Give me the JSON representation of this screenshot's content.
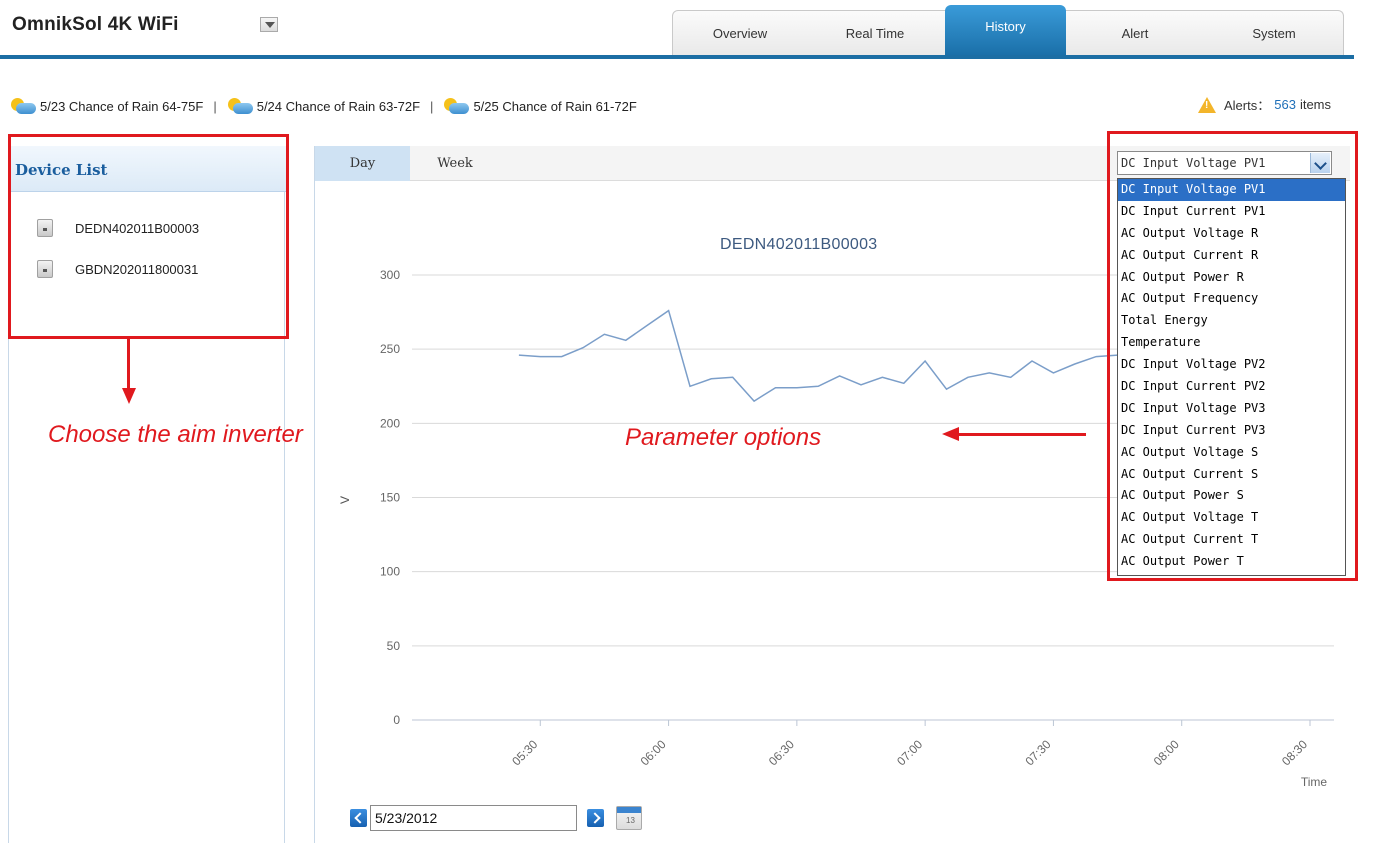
{
  "app": {
    "title": "OmnikSol 4K WiFi"
  },
  "tabs": [
    {
      "label": "Overview",
      "active": false
    },
    {
      "label": "Real Time",
      "active": false
    },
    {
      "label": "History",
      "active": true
    },
    {
      "label": "Alert",
      "active": false
    },
    {
      "label": "System",
      "active": false
    }
  ],
  "weather": [
    {
      "text": "5/23 Chance of Rain 64-75F",
      "icon": "partly-cloudy-icon"
    },
    {
      "text": "5/24 Chance of Rain 63-72F",
      "icon": "partly-cloudy-icon"
    },
    {
      "text": "5/25 Chance of Rain 61-72F",
      "icon": "partly-cloudy-icon"
    }
  ],
  "weather_separator": "|",
  "alerts": {
    "label": "Alerts：",
    "count": "563",
    "suffix": "items"
  },
  "device_list": {
    "title": "Device List",
    "devices": [
      "DEDN402011B00003",
      "GBDN202011800031"
    ]
  },
  "annotations": {
    "choose": "Choose the aim inverter",
    "params": "Parameter options"
  },
  "chart_tabs": [
    {
      "label": "Day",
      "active": true
    },
    {
      "label": "Week",
      "active": false
    }
  ],
  "parameter_select": {
    "selected": "DC Input Voltage PV1",
    "options": [
      "DC Input Voltage PV1",
      "DC Input Current PV1",
      "AC Output Voltage R",
      "AC Output Current R",
      "AC Output Power R",
      "AC Output Frequency",
      "Total Energy",
      "Temperature",
      "DC Input Voltage PV2",
      "DC Input Current PV2",
      "DC Input Voltage PV3",
      "DC Input Current PV3",
      "AC Output Voltage S",
      "AC Output Current S",
      "AC Output Power S",
      "AC Output Voltage T",
      "AC Output Current T",
      "AC Output Power T"
    ]
  },
  "date_picker": {
    "value": "5/23/2012",
    "calendar_icon_text": "13"
  },
  "chart_data": {
    "type": "line",
    "title": "DEDN402011B00003",
    "ylabel": "V",
    "xlabel": "Time",
    "ylim": [
      0,
      300
    ],
    "yticks": [
      0,
      50,
      100,
      150,
      200,
      250,
      300
    ],
    "ytick_labels": [
      "0",
      "50",
      "100",
      "150",
      "200",
      "250",
      "300"
    ],
    "xlim": [
      "05:00",
      "08:30"
    ],
    "xticks": [
      "05:30",
      "06:00",
      "06:30",
      "07:00",
      "07:30",
      "08:00",
      "08:30"
    ],
    "grid": true,
    "line_color": "#7b9ec9",
    "series": [
      {
        "x": [
          "05:25",
          "05:30",
          "05:35",
          "05:40",
          "05:45",
          "05:50",
          "05:55",
          "06:00",
          "06:05",
          "06:10",
          "06:15",
          "06:20",
          "06:25",
          "06:30",
          "06:35",
          "06:40",
          "06:45",
          "06:50",
          "06:55",
          "07:00",
          "07:05",
          "07:10",
          "07:15",
          "07:20",
          "07:25",
          "07:30",
          "07:35",
          "07:40",
          "07:45"
        ],
        "values": [
          246,
          245,
          245,
          251,
          260,
          256,
          266,
          276,
          225,
          230,
          231,
          215,
          224,
          224,
          225,
          232,
          226,
          231,
          227,
          242,
          223,
          231,
          234,
          231,
          242,
          234,
          240,
          245,
          246
        ]
      }
    ]
  }
}
